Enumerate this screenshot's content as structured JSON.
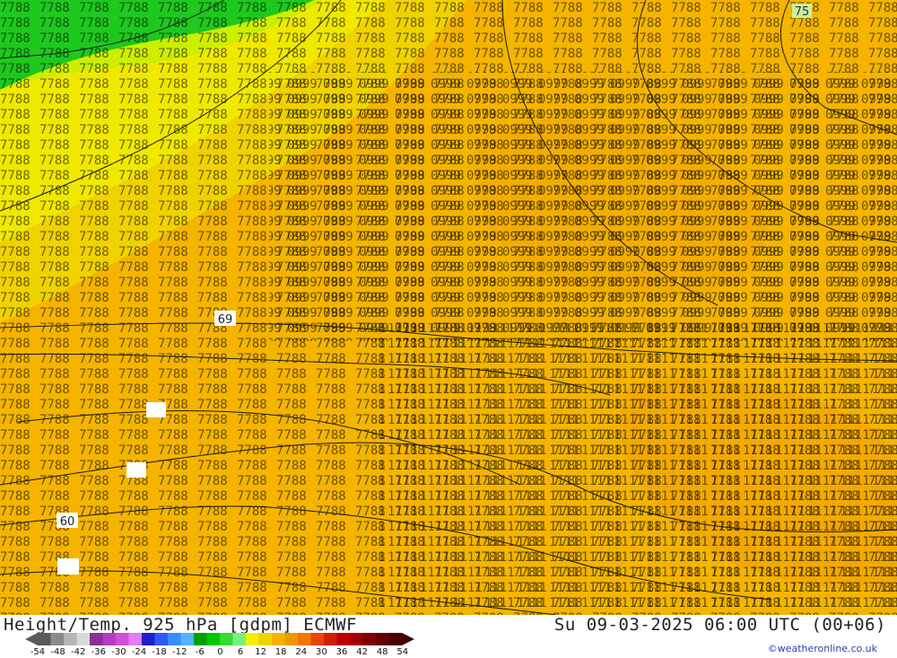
{
  "map": {
    "contour_labels": [
      "75",
      "69",
      "60"
    ]
  },
  "footer": {
    "title": "Height/Temp. 925 hPa [gdpm] ECMWF",
    "datetime": "Su 09-03-2025 06:00 UTC (00+06)",
    "credit": "©weatheronline.co.uk"
  },
  "legend": {
    "ticks": [
      "-54",
      "-48",
      "-42",
      "-36",
      "-30",
      "-24",
      "-18",
      "-12",
      "-6",
      "0",
      "6",
      "12",
      "18",
      "24",
      "30",
      "36",
      "42",
      "48",
      "54"
    ],
    "colors": [
      "#5a5a5a",
      "#8a8a8a",
      "#b4b4b4",
      "#d8d8d8",
      "#8c2f96",
      "#b43cc0",
      "#d24ed8",
      "#e67cf0",
      "#1e1ed2",
      "#2d5af0",
      "#3c8cff",
      "#50b4ff",
      "#00a000",
      "#00c800",
      "#32dc32",
      "#78f078",
      "#f0f000",
      "#f0d200",
      "#f0b400",
      "#f09600",
      "#f07800",
      "#e64600",
      "#d21e00",
      "#be0000",
      "#a00000",
      "#820000",
      "#640000",
      "#460000"
    ]
  }
}
